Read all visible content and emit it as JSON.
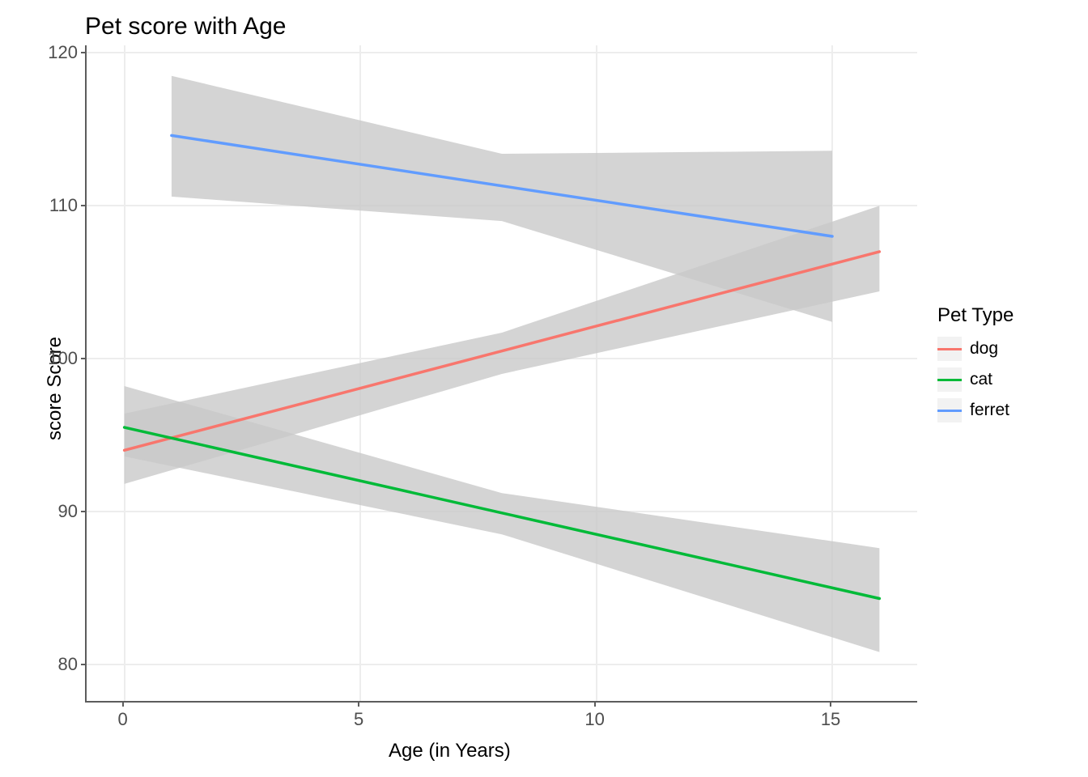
{
  "chart_data": {
    "type": "line",
    "title": "Pet score with Age",
    "xlabel": "Age (in Years)",
    "ylabel": "score Score",
    "xlim": [
      -0.8,
      16.8
    ],
    "ylim": [
      77.6,
      120.5
    ],
    "x_ticks": [
      0,
      5,
      10,
      15
    ],
    "y_ticks": [
      80,
      90,
      100,
      110,
      120
    ],
    "legend_title": "Pet Type",
    "series": [
      {
        "name": "dog",
        "color": "#F8766D",
        "x": [
          0,
          16
        ],
        "y": [
          94.0,
          107.0
        ],
        "ribbon_lower": [
          91.8,
          104.4
        ],
        "ribbon_upper": [
          96.4,
          110.0
        ]
      },
      {
        "name": "cat",
        "color": "#00BA38",
        "x": [
          0,
          16
        ],
        "y": [
          95.5,
          84.3
        ],
        "ribbon_lower": [
          93.6,
          80.8
        ],
        "ribbon_upper": [
          98.2,
          87.6
        ]
      },
      {
        "name": "ferret",
        "color": "#619CFF",
        "x": [
          1,
          15
        ],
        "y": [
          114.6,
          108.0
        ],
        "ribbon_lower": [
          110.6,
          102.4
        ],
        "ribbon_upper": [
          118.5,
          113.6
        ]
      }
    ],
    "ribbons": [
      {
        "series": "dog",
        "x": [
          0,
          8,
          16
        ],
        "lower": [
          91.8,
          99.0,
          104.4
        ],
        "upper": [
          96.4,
          101.7,
          110.0
        ]
      },
      {
        "series": "cat",
        "x": [
          0,
          8,
          16
        ],
        "lower": [
          93.6,
          88.5,
          80.8
        ],
        "upper": [
          98.2,
          91.2,
          87.6
        ]
      },
      {
        "series": "ferret",
        "x": [
          1,
          8,
          15
        ],
        "lower": [
          110.6,
          109.0,
          102.4
        ],
        "upper": [
          118.5,
          113.4,
          113.6
        ]
      }
    ]
  },
  "colors": {
    "dog": "#F8766D",
    "cat": "#00BA38",
    "ferret": "#619CFF",
    "ribbon": "#C8C8C8",
    "grid": "#ededed",
    "axis": "#5c5c5c"
  }
}
